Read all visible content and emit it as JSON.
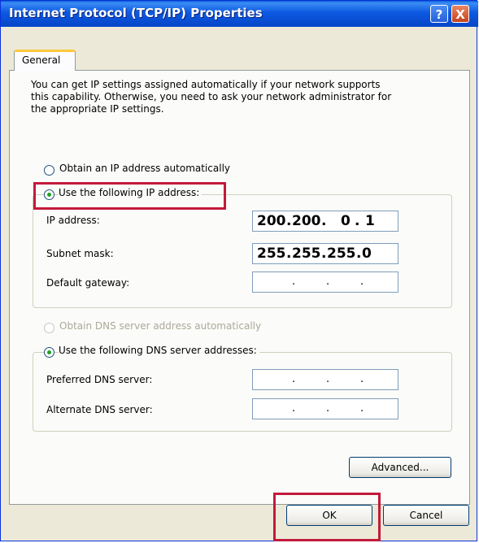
{
  "window": {
    "title": "Internet Protocol (TCP/IP) Properties",
    "help_label": "?",
    "close_label": "X"
  },
  "tabs": [
    {
      "label": "General"
    }
  ],
  "intro_text": "You can get IP settings assigned automatically if your network supports\nthis capability. Otherwise, you need to ask your network administrator for\nthe appropriate IP settings.",
  "ip_section": {
    "auto_label": "Obtain an IP address automatically",
    "auto_selected": false,
    "manual_label": "Use the following IP address:",
    "manual_selected": true,
    "fields": [
      {
        "label": "IP address:",
        "octets": [
          "200",
          "200",
          "0",
          "1"
        ]
      },
      {
        "label": "Subnet mask:",
        "octets": [
          "255",
          "255",
          "255",
          "0"
        ]
      },
      {
        "label": "Default gateway:",
        "octets": [
          "",
          "",
          "",
          ""
        ]
      }
    ]
  },
  "dns_section": {
    "auto_label": "Obtain DNS server address automatically",
    "auto_enabled": false,
    "manual_label": "Use the following DNS server addresses:",
    "manual_selected": true,
    "fields": [
      {
        "label": "Preferred DNS server:",
        "octets": [
          "",
          "",
          "",
          ""
        ]
      },
      {
        "label": "Alternate DNS server:",
        "octets": [
          "",
          "",
          "",
          ""
        ]
      }
    ]
  },
  "buttons": {
    "advanced": "Advanced...",
    "ok": "OK",
    "cancel": "Cancel"
  },
  "colors": {
    "titlebar": "#0a5fd8",
    "highlight": "#c21a3c",
    "radio_dot": "#21a121"
  }
}
